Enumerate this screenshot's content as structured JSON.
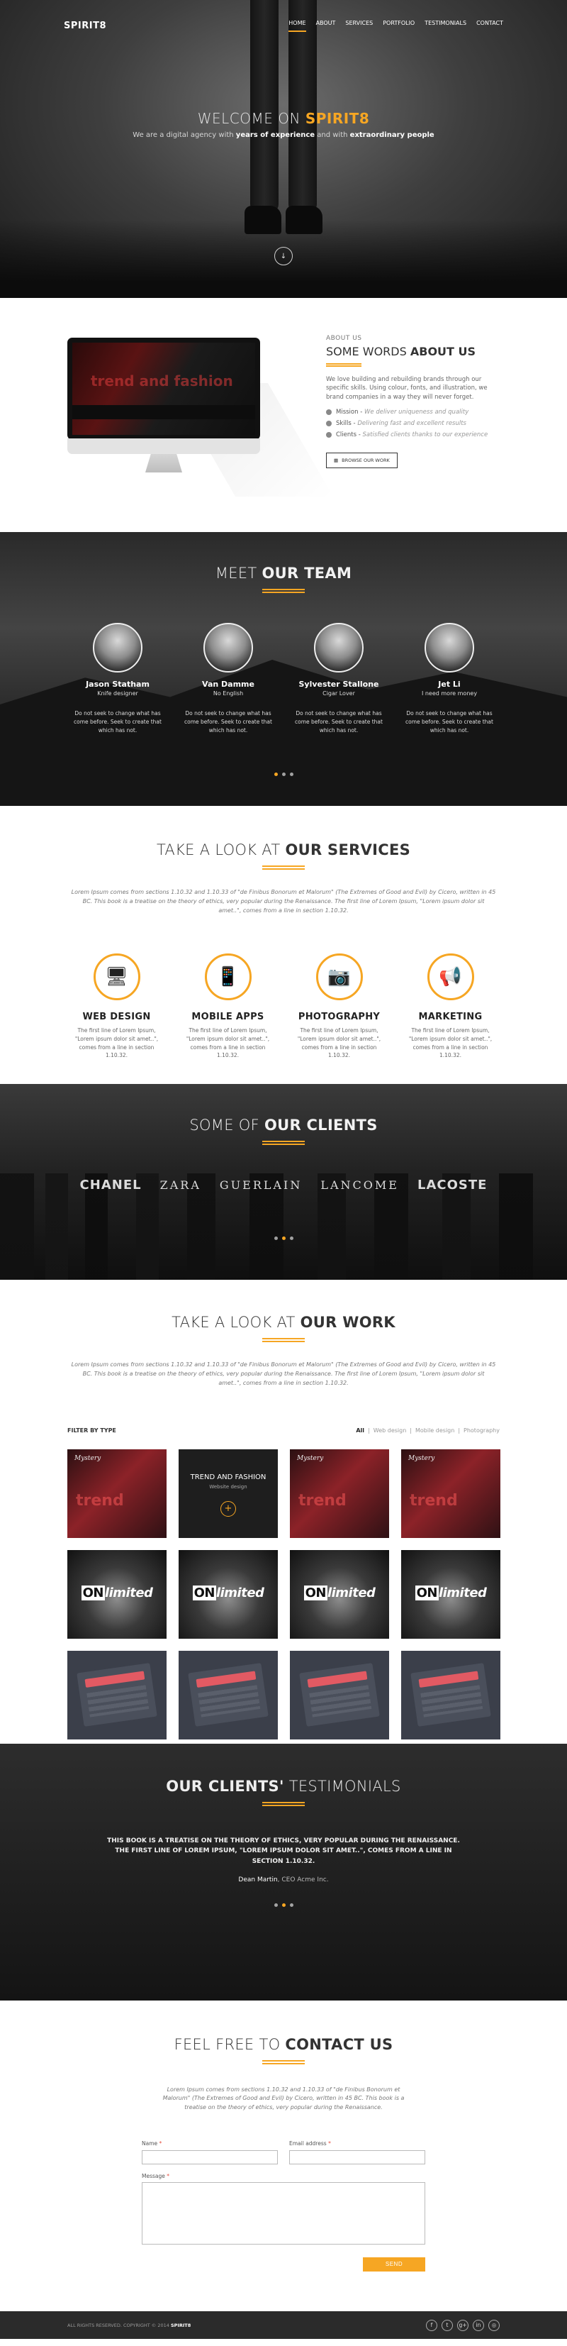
{
  "nav": {
    "logo": "SPIRIT8",
    "items": [
      "HOME",
      "ABOUT",
      "SERVICES",
      "PORTFOLIO",
      "TESTIMONIALS",
      "CONTACT"
    ],
    "active": "HOME"
  },
  "hero": {
    "title_light": "WELCOME ON",
    "title_accent": "SPIRIT8",
    "sub_1": "We are a digital agency with",
    "sub_b1": "years of experience",
    "sub_2": "and with",
    "sub_b2": "extraordinary people",
    "scroll_icon": "arrow-down-icon"
  },
  "about": {
    "kicker": "ABOUT US",
    "title_light": "SOME WORDS",
    "title_bold": "ABOUT US",
    "paragraph": "We love building and rebuilding brands through our specific skills. Using colour, fonts, and illustration, we brand companies in a way they will never forget.",
    "bullets": [
      {
        "label": "Mission",
        "desc": "We deliver uniqueness and quality"
      },
      {
        "label": "Skills",
        "desc": "Delivering fast and excellent results"
      },
      {
        "label": "Clients",
        "desc": "Satisfied clients thanks to our experience"
      }
    ],
    "button": "BROWSE OUR WORK",
    "screen_text": "trend and fashion"
  },
  "team": {
    "title_light": "MEET",
    "title_bold": "OUR TEAM",
    "members": [
      {
        "name": "Jason Statham",
        "role": "Knife designer",
        "desc": "Do not seek to change what has come before. Seek to create that which has not."
      },
      {
        "name": "Van Damme",
        "role": "No English",
        "desc": "Do not seek to change what has come before. Seek to create that which has not."
      },
      {
        "name": "Sylvester Stallone",
        "role": "Cigar Lover",
        "desc": "Do not seek to change what has come before. Seek to create that which has not."
      },
      {
        "name": "Jet Li",
        "role": "I need more money",
        "desc": "Do not seek to change what has come before. Seek to create that which has not."
      }
    ]
  },
  "services": {
    "title_light": "TAKE A LOOK AT",
    "title_bold": "OUR SERVICES",
    "intro": "Lorem Ipsum comes from sections 1.10.32 and 1.10.33 of \"de Finibus Bonorum et Malorum\" (The Extremes of Good and Evil) by Cicero, written in 45 BC. This book is a treatise on the theory of ethics, very popular during the Renaissance. The first line of Lorem Ipsum, \"Lorem ipsum dolor sit amet..\", comes from a line in section 1.10.32.",
    "items": [
      {
        "icon": "monitor-icon",
        "glyph": "🖥",
        "title": "WEB DESIGN",
        "desc": "The first line of Lorem Ipsum, \"Lorem ipsum dolor sit amet..\", comes from a line in section 1.10.32."
      },
      {
        "icon": "mobile-icon",
        "glyph": "📱",
        "title": "MOBILE APPS",
        "desc": "The first line of Lorem Ipsum, \"Lorem ipsum dolor sit amet..\", comes from a line in section 1.10.32."
      },
      {
        "icon": "camera-icon",
        "glyph": "📷",
        "title": "PHOTOGRAPHY",
        "desc": "The first line of Lorem Ipsum, \"Lorem ipsum dolor sit amet..\", comes from a line in section 1.10.32."
      },
      {
        "icon": "megaphone-icon",
        "glyph": "📢",
        "title": "MARKETING",
        "desc": "The first line of Lorem Ipsum, \"Lorem ipsum dolor sit amet..\", comes from a line in section 1.10.32."
      }
    ]
  },
  "clients": {
    "title_light": "SOME OF",
    "title_bold": "OUR CLIENTS",
    "brands": [
      "CHANEL",
      "ZARA",
      "GUERLAIN",
      "LANCOME",
      "LACOSTE"
    ]
  },
  "work": {
    "title_light": "TAKE A LOOK AT",
    "title_bold": "OUR WORK",
    "intro": "Lorem Ipsum comes from sections 1.10.32 and 1.10.33 of \"de Finibus Bonorum et Malorum\" (The Extremes of Good and Evil) by Cicero, written in 45 BC. This book is a treatise on the theory of ethics, very popular during the Renaissance. The first line of Lorem Ipsum, \"Lorem ipsum dolor sit amet..\", comes from a line in section 1.10.32.",
    "filter_label": "FILTER BY TYPE",
    "filters": [
      "All",
      "Web design",
      "Mobile design",
      "Photography"
    ],
    "active_filter": "All",
    "hover_title": "TREND AND FASHION",
    "hover_sub": "Website design",
    "tile_mark": "Mystery",
    "tile_word": "trend",
    "unlimited_1": "ON",
    "unlimited_2": "limited"
  },
  "testimonials": {
    "title_bold": "OUR CLIENTS'",
    "title_light": "TESTIMONIALS",
    "quote": "This book is a treatise on the theory of ethics, very popular during the Renaissance. The first line of Lorem Ipsum, \"Lorem ipsum dolor sit amet..\", comes from a line in section 1.10.32.",
    "author": "Dean Martin",
    "company": ", CEO Acme Inc."
  },
  "contact": {
    "title_light": "FEEL FREE TO",
    "title_bold": "CONTACT US",
    "intro": "Lorem Ipsum comes from sections 1.10.32 and 1.10.33 of \"de Finibus Bonorum et Malorum\" (The Extremes of Good and Evil) by Cicero, written in 45 BC. This book is a treatise on the theory of ethics, very popular during the Renaissance.",
    "name_label": "Name",
    "email_label": "Email address",
    "message_label": "Message",
    "send": "SEND"
  },
  "footer": {
    "copyright": "ALL RIGHTS RESERVED. COPYRIGHT © 2014",
    "brand": "SPIRIT8",
    "socials": [
      "facebook-icon",
      "twitter-icon",
      "google-plus-icon",
      "linkedin-icon",
      "dribbble-icon"
    ],
    "social_glyphs": [
      "f",
      "t",
      "g+",
      "in",
      "◎"
    ]
  },
  "colors": {
    "accent": "#f6a623",
    "dark": "#1e1e1e",
    "footer": "#2b2b2b"
  }
}
